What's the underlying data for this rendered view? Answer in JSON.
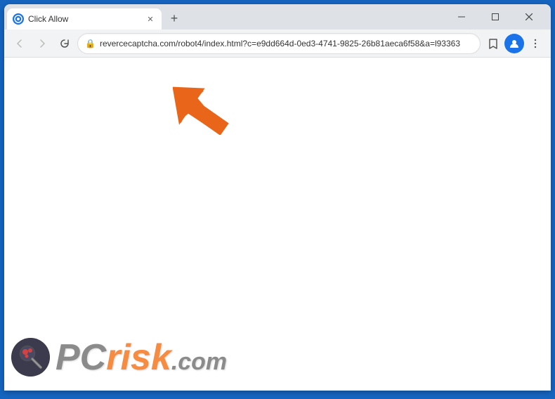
{
  "window": {
    "title": "Click Allow",
    "url": "revercecaptcha.com/robot4/index.html?c=e9dd664d-0ed3-4741-9825-26b81aeca6f58&a=l93363",
    "favicon": "C"
  },
  "toolbar": {
    "back_label": "←",
    "forward_label": "→",
    "reload_label": "✕",
    "new_tab_label": "+",
    "star_label": "☆",
    "menu_label": "⋮"
  },
  "window_controls": {
    "minimize": "—",
    "maximize": "□",
    "close": "✕"
  },
  "watermark": {
    "pc_text": "PC",
    "risk_text": "risk",
    "dotcom_text": ".com"
  }
}
